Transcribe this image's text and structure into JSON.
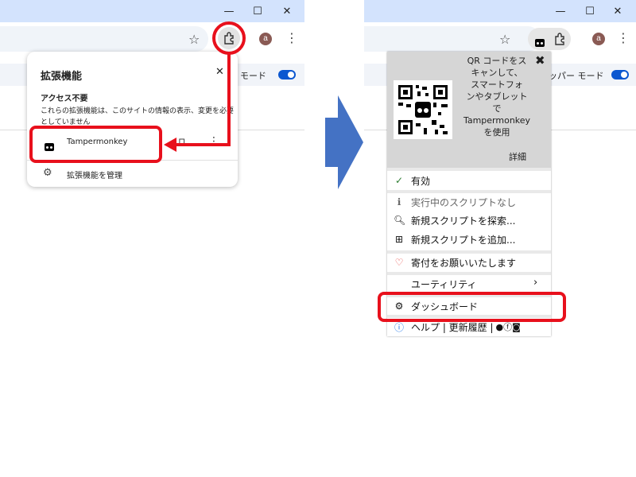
{
  "left": {
    "extensions_popup": {
      "title": "拡張機能",
      "close_icon": "✕",
      "access_heading": "アクセス不要",
      "access_description_1": "これらの拡張機能は、このサイトの情報の表示、変更を必要",
      "access_description_2": "としていません",
      "extension_name": "Tampermonkey",
      "manage_label": "拡張機能を管理"
    },
    "page_mode_label": "モード"
  },
  "right": {
    "page_mode_label": "ッパー モード",
    "qr_text": "QR コードをスキャンして、スマートフォンやタブレットでTampermonkeyを使用",
    "qr_lines": [
      "QR コードをス",
      "キャンして、",
      "スマートフォ",
      "ンやタブレット",
      "で",
      "Tampermonkey",
      "を使用"
    ],
    "close_icon": "✖",
    "details_label": "詳細",
    "menu": {
      "enabled": "有効",
      "no_scripts": "実行中のスクリプトなし",
      "find_scripts": "新規スクリプトを探索...",
      "add_script": "新規スクリプトを追加...",
      "donate": "寄付をお願いいたします",
      "utilities": "ユーティリティ",
      "dashboard": "ダッシュボード",
      "help": "ヘルプ | 更新履歴 |"
    }
  },
  "window_controls": {
    "minimize": "—",
    "maximize": "☐",
    "close": "✕"
  },
  "avatar_letter": "a",
  "colors": {
    "accent": "#0b57d0",
    "highlight": "#e8101c",
    "arrow": "#4472c4",
    "title_bar": "#d3e3fd"
  }
}
